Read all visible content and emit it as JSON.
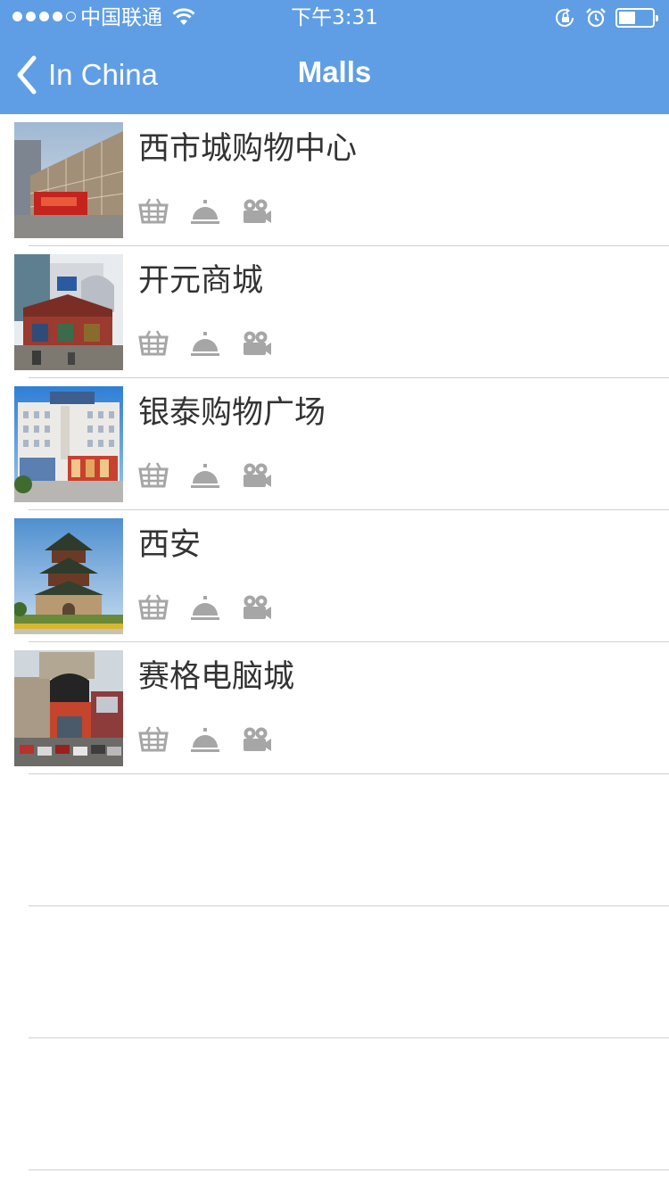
{
  "status_bar": {
    "carrier": "中国联通",
    "time": "下午3:31",
    "signal_bars_filled": 4,
    "signal_bars_total": 5,
    "battery_level": 0.5
  },
  "nav": {
    "back_label": "In China",
    "title": "Malls"
  },
  "colors": {
    "nav_background": "#5f9ee4",
    "row_text": "#333333",
    "icon_gray": "#a6a6a6",
    "separator": "#cfcfd3"
  },
  "malls": [
    {
      "name": "西市城购物中心",
      "icons": [
        "basket-icon",
        "service-bell-icon",
        "video-camera-icon"
      ]
    },
    {
      "name": "开元商城",
      "icons": [
        "basket-icon",
        "service-bell-icon",
        "video-camera-icon"
      ]
    },
    {
      "name": "银泰购物广场",
      "icons": [
        "basket-icon",
        "service-bell-icon",
        "video-camera-icon"
      ]
    },
    {
      "name": "西安",
      "icons": [
        "basket-icon",
        "service-bell-icon",
        "video-camera-icon"
      ]
    },
    {
      "name": "赛格电脑城",
      "icons": [
        "basket-icon",
        "service-bell-icon",
        "video-camera-icon"
      ]
    }
  ]
}
